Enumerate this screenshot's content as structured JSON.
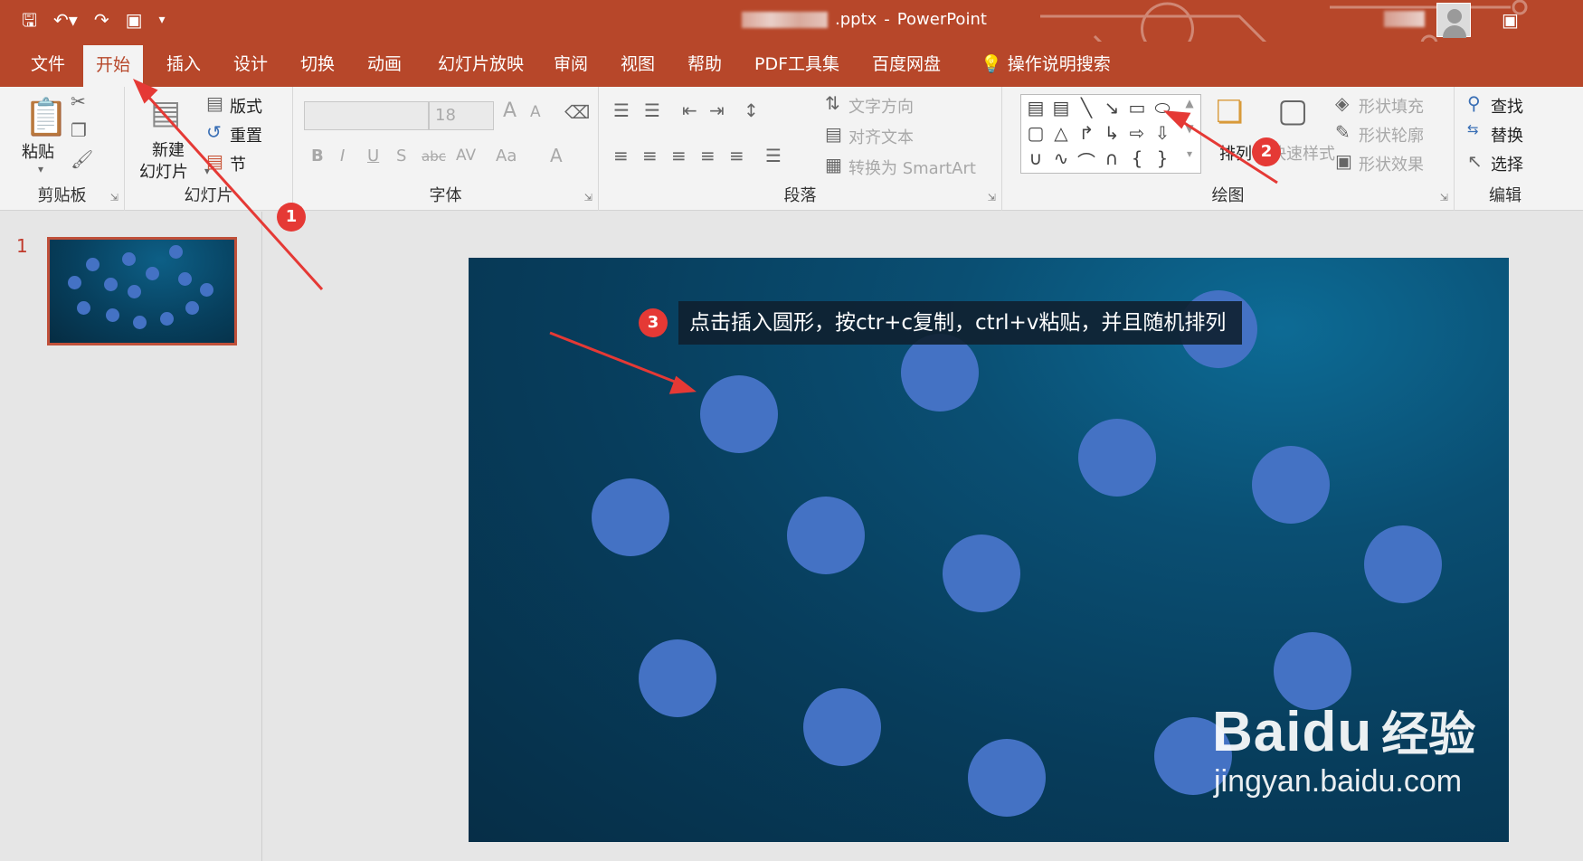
{
  "titlebar": {
    "filename_suffix": ".pptx",
    "separator": "-",
    "app_name": "PowerPoint",
    "qat": {
      "save": "save-icon",
      "undo": "undo-icon",
      "redo": "redo-icon",
      "present": "from-beginning-icon",
      "customize": "customize-qat-icon"
    }
  },
  "tabs": [
    "文件",
    "开始",
    "插入",
    "设计",
    "切换",
    "动画",
    "幻灯片放映",
    "审阅",
    "视图",
    "帮助",
    "PDF工具集",
    "百度网盘"
  ],
  "tell_me": "操作说明搜索",
  "ribbon": {
    "clipboard": {
      "paste": "粘贴",
      "label": "剪贴板"
    },
    "slides": {
      "new_slide_line1": "新建",
      "new_slide_line2": "幻灯片",
      "layout": "版式",
      "reset": "重置",
      "section": "节",
      "label": "幻灯片"
    },
    "font": {
      "font_name": "",
      "font_size": "18",
      "bold": "B",
      "italic": "I",
      "underline": "U",
      "shadow": "S",
      "strike": "abc",
      "spacing": "AV",
      "case": "Aa",
      "color": "A",
      "grow": "A",
      "shrink": "A",
      "label": "字体"
    },
    "paragraph": {
      "text_direction": "文字方向",
      "align_text": "对齐文本",
      "smartart": "转换为 SmartArt",
      "label": "段落"
    },
    "drawing": {
      "arrange": "排列",
      "quick_styles": "快速样式",
      "shape_fill": "形状填充",
      "shape_outline": "形状轮廓",
      "shape_effects": "形状效果",
      "label": "绘图"
    },
    "editing": {
      "find": "查找",
      "replace": "替换",
      "select": "选择",
      "label": "编辑"
    }
  },
  "slides_pane": {
    "slide_number": "1"
  },
  "annotation": {
    "step1": "1",
    "step2": "2",
    "step3": "3",
    "callout": "点击插入圆形，按ctr+c复制，ctrl+v粘贴，并且随机排列",
    "color": "#e53935"
  },
  "watermark": {
    "logo": "Bai",
    "logo2": "du",
    "cn": "经验",
    "url": "jingyan.baidu.com"
  },
  "colors": {
    "accent": "#b7472a",
    "circle": "#4472c4",
    "slide_bg": "#073d5c"
  }
}
